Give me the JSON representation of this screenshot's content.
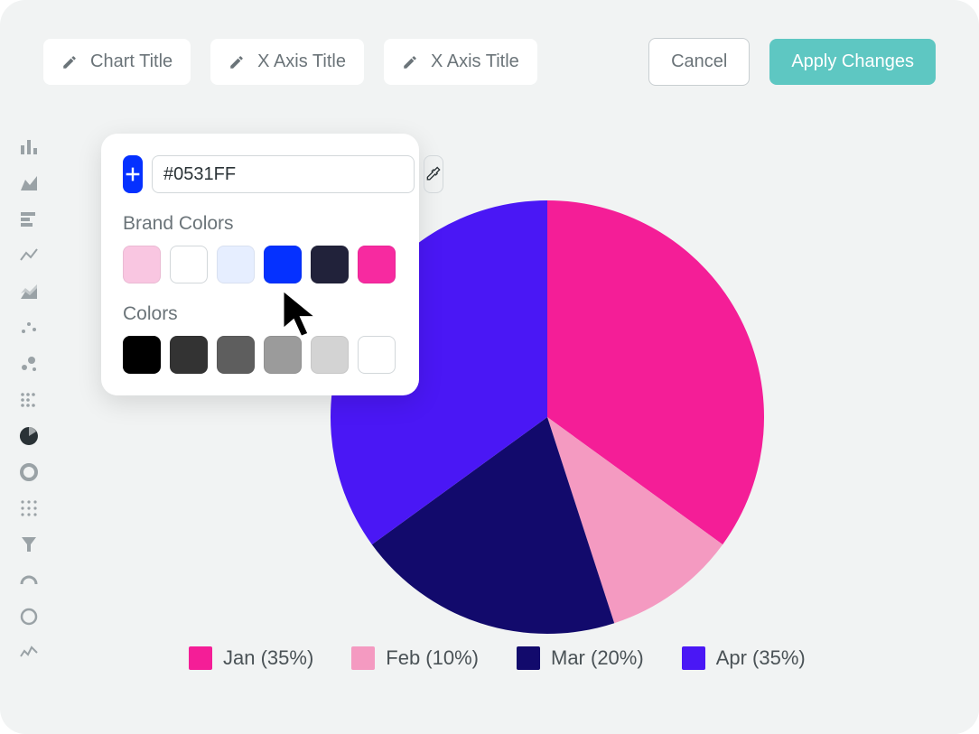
{
  "toolbar": {
    "chart_title_placeholder": "Chart Title",
    "x_axis_title_placeholder": "X Axis Title",
    "y_axis_title_placeholder": "X Axis Title",
    "cancel_label": "Cancel",
    "apply_label": "Apply Changes"
  },
  "rail": {
    "items": [
      "bar-chart-icon",
      "area-chart-icon",
      "horizontal-bar-icon",
      "line-chart-icon",
      "stacked-area-icon",
      "scatter-icon",
      "bubble-icon",
      "dot-plot-icon",
      "pie-chart-icon",
      "donut-chart-icon",
      "grid-chart-icon",
      "funnel-icon",
      "gauge-icon",
      "ring-icon",
      "spark-icon"
    ],
    "active_index": 8
  },
  "popover": {
    "hex_value": "#0531FF",
    "brand_colors_label": "Brand Colors",
    "colors_label": "Colors",
    "brand_colors": [
      "#F9C6E1",
      "#FFFFFF",
      "#E6EEFF",
      "#0531FF",
      "#21223A",
      "#F72AA0"
    ],
    "colors": [
      "#000000",
      "#333333",
      "#5E5E5E",
      "#9B9B9B",
      "#D3D3D3",
      "#FFFFFF"
    ]
  },
  "chart_data": {
    "type": "pie",
    "title": "",
    "series": [
      {
        "name": "Jan",
        "value": 35,
        "color": "#F41E97"
      },
      {
        "name": "Feb",
        "value": 10,
        "color": "#F49AC1"
      },
      {
        "name": "Mar",
        "value": 20,
        "color": "#120A6C"
      },
      {
        "name": "Apr",
        "value": 35,
        "color": "#4A17F5"
      }
    ],
    "legend_format": "{name} ({value}%)",
    "start_angle_deg": 0
  }
}
